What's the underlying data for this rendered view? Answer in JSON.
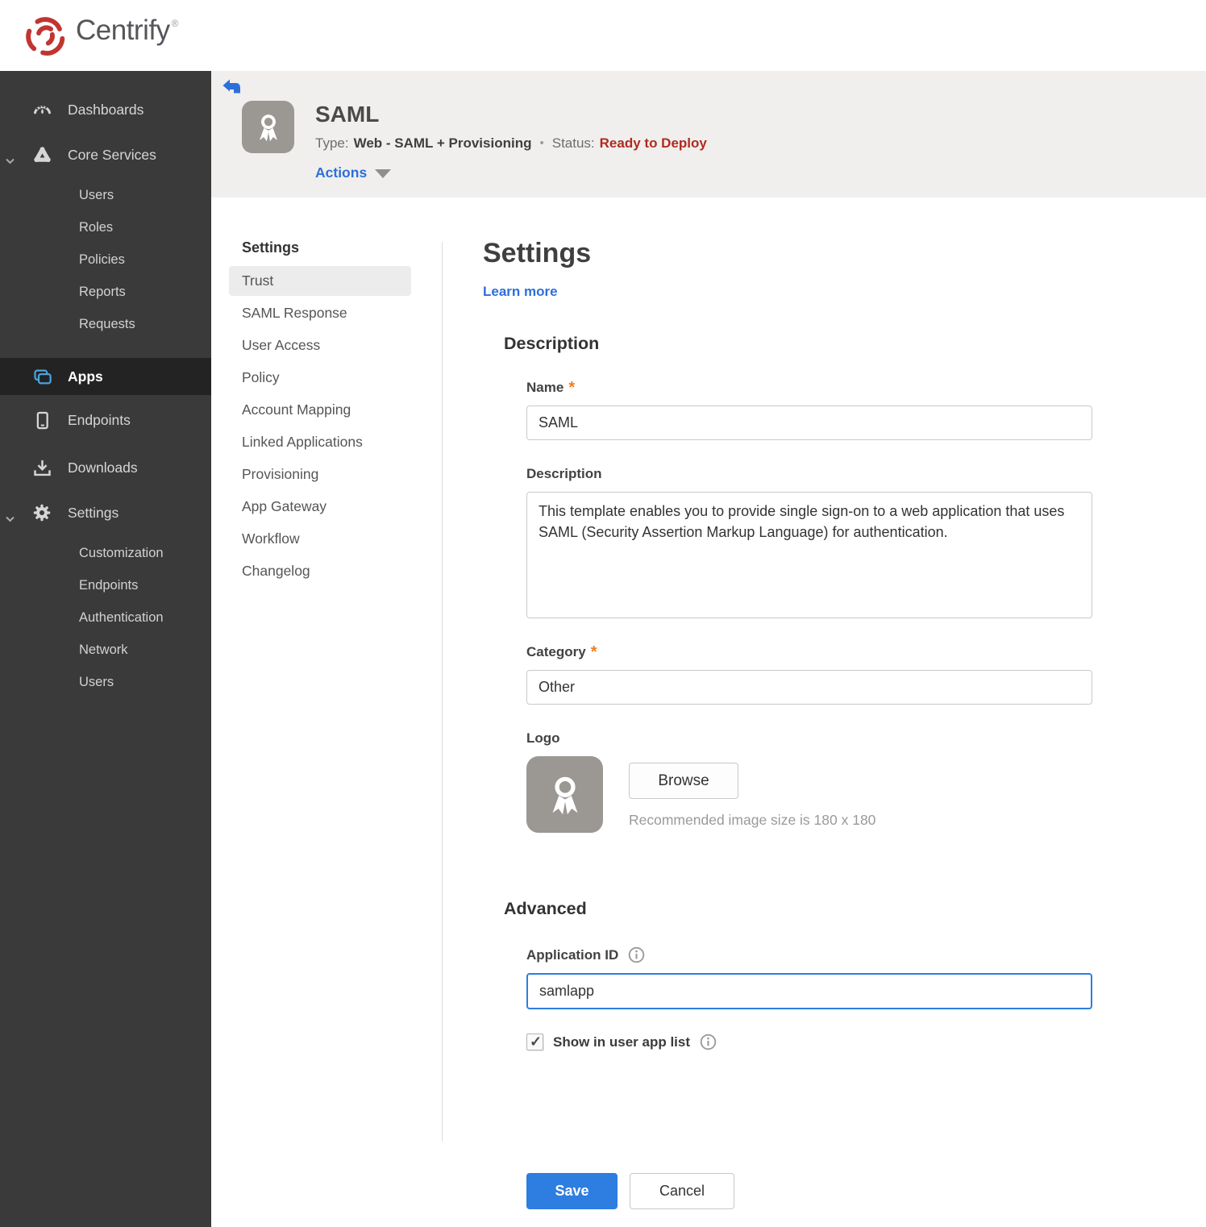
{
  "brand": {
    "name": "Centrify",
    "trademark": "®",
    "logo_color": "#c13530"
  },
  "sidebar": {
    "items": [
      {
        "label": "Dashboards",
        "icon": "dashboards"
      },
      {
        "label": "Core Services",
        "icon": "core-services",
        "expanded": true,
        "children": [
          "Users",
          "Roles",
          "Policies",
          "Reports",
          "Requests"
        ]
      },
      {
        "label": "Apps",
        "icon": "apps",
        "active": true
      },
      {
        "label": "Endpoints",
        "icon": "endpoints"
      },
      {
        "label": "Downloads",
        "icon": "downloads"
      },
      {
        "label": "Settings",
        "icon": "settings",
        "expanded": true,
        "children": [
          "Customization",
          "Endpoints",
          "Authentication",
          "Network",
          "Users"
        ]
      }
    ]
  },
  "header": {
    "app_name": "SAML",
    "type_label": "Type:",
    "type_value": "Web - SAML + Provisioning",
    "separator": "•",
    "status_label": "Status:",
    "status_value": "Ready to Deploy",
    "actions_label": "Actions"
  },
  "subnav": {
    "heading": "Settings",
    "items": [
      {
        "label": "Trust",
        "active": true
      },
      {
        "label": "SAML Response"
      },
      {
        "label": "User Access"
      },
      {
        "label": "Policy"
      },
      {
        "label": "Account Mapping"
      },
      {
        "label": "Linked Applications"
      },
      {
        "label": "Provisioning"
      },
      {
        "label": "App Gateway"
      },
      {
        "label": "Workflow"
      },
      {
        "label": "Changelog"
      }
    ]
  },
  "main": {
    "title": "Settings",
    "learn_more": "Learn more",
    "required_mark": "*",
    "description_section": {
      "heading": "Description",
      "name_field": {
        "label": "Name",
        "required": true,
        "value": "SAML"
      },
      "description_field": {
        "label": "Description",
        "value": "This template enables you to provide single sign-on to a web application that uses SAML (Security Assertion Markup Language) for authentication."
      },
      "category_field": {
        "label": "Category",
        "required": true,
        "value": "Other"
      },
      "logo_field": {
        "label": "Logo",
        "browse_label": "Browse",
        "hint": "Recommended image size is 180 x 180"
      }
    },
    "advanced_section": {
      "heading": "Advanced",
      "application_id_field": {
        "label": "Application ID",
        "value": "samlapp",
        "focused": true
      },
      "show_in_list": {
        "label": "Show in user app list",
        "checked": true
      }
    },
    "footer": {
      "save_label": "Save",
      "cancel_label": "Cancel"
    }
  },
  "colors": {
    "accent_blue": "#2e7de1",
    "link_blue": "#2e6fd9",
    "status_red": "#b02b21",
    "asterisk_orange": "#ef7d23",
    "sidebar_bg": "#3a3a3a",
    "sidebar_active_bg": "#232323",
    "header_bg": "#f0efed",
    "icon_blue": "#4aa3e0"
  }
}
